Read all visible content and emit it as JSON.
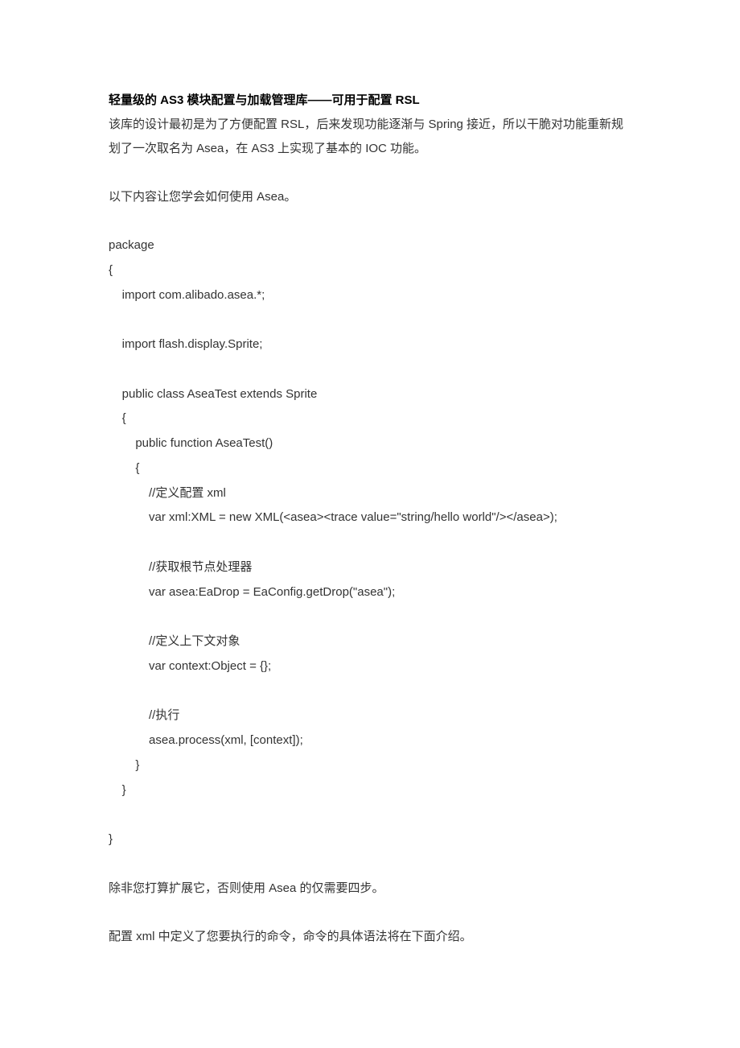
{
  "title": "轻量级的 AS3 模块配置与加载管理库——可用于配置 RSL",
  "intro_para_1": "该库的设计最初是为了方便配置 RSL，后来发现功能逐渐与 Spring 接近，所以干脆对功能重新规划了一次取名为 Asea，在 AS3 上实现了基本的 IOC 功能。",
  "intro_para_2": "以下内容让您学会如何使用 Asea。",
  "code": "package\n{\n    import com.alibado.asea.*;\n\n    import flash.display.Sprite;\n\n    public class AseaTest extends Sprite\n    {\n        public function AseaTest()\n        {\n            //定义配置 xml\n            var xml:XML = new XML(<asea><trace value=\"string/hello world\"/></asea>);\n\n            //获取根节点处理器\n            var asea:EaDrop = EaConfig.getDrop(\"asea\");\n\n            //定义上下文对象\n            var context:Object = {};\n\n            //执行\n            asea.process(xml, [context]);\n        }\n    }\n\n}",
  "outro_para_1": "除非您打算扩展它，否则使用 Asea 的仅需要四步。",
  "outro_para_2": "配置 xml 中定义了您要执行的命令，命令的具体语法将在下面介绍。"
}
